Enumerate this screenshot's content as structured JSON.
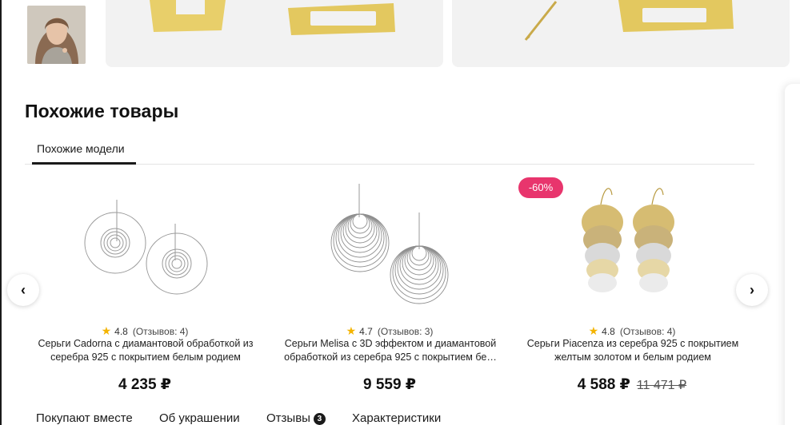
{
  "gallery": {
    "thumbnail_alt": "model-thumbnail"
  },
  "similar": {
    "title": "Похожие товары",
    "tab_label": "Похожие модели",
    "discount_badge": "-60%",
    "products": [
      {
        "rating": "4.8",
        "reviews": "(Отзывов: 4)",
        "name": "Серьги Cadorna с диамантовой обработкой из серебра 925 с покрытием белым родием",
        "price": "4 235 ₽",
        "old_price": ""
      },
      {
        "rating": "4.7",
        "reviews": "(Отзывов: 3)",
        "name": "Серьги Melisa с 3D эффектом и диамантовой обработкой из серебра 925 с покрытием бе…",
        "price": "9 559 ₽",
        "old_price": ""
      },
      {
        "rating": "4.8",
        "reviews": "(Отзывов: 4)",
        "name": "Серьги Piacenza из серебра 925 с покрытием желтым золотом и белым родием",
        "price": "4 588 ₽",
        "old_price": "11 471 ₽"
      }
    ]
  },
  "bottom_nav": {
    "items": [
      "Покупают вместе",
      "Об украшении",
      "Отзывы",
      "Характеристики"
    ],
    "reviews_count": "3"
  },
  "icons": {
    "prev": "chevron-left-icon",
    "next": "chevron-right-icon",
    "star": "star-icon"
  },
  "colors": {
    "accent_pink": "#e8356d",
    "star": "#f4b400",
    "gold": "#e8cf6a"
  }
}
